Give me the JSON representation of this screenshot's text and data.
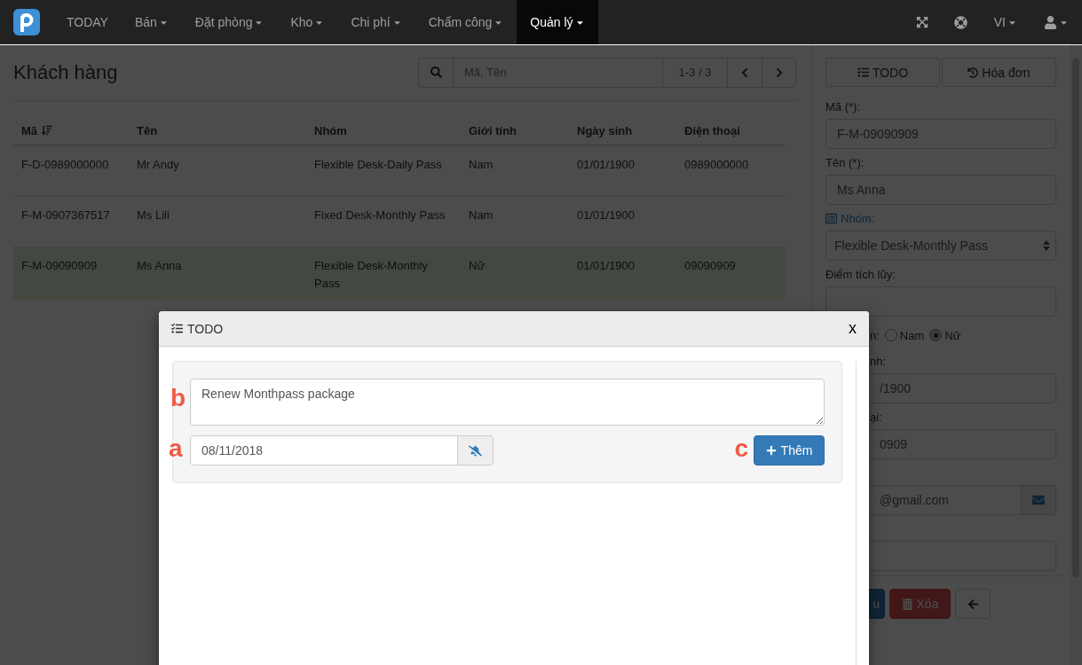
{
  "navbar": {
    "items": [
      {
        "label": "TODAY",
        "dropdown": false,
        "selected": false
      },
      {
        "label": "Bán",
        "dropdown": true,
        "selected": false
      },
      {
        "label": "Đặt phòng",
        "dropdown": true,
        "selected": false
      },
      {
        "label": "Kho",
        "dropdown": true,
        "selected": false
      },
      {
        "label": "Chi phí",
        "dropdown": true,
        "selected": false
      },
      {
        "label": "Chấm công",
        "dropdown": true,
        "selected": false
      },
      {
        "label": "Quản lý",
        "dropdown": true,
        "selected": true
      }
    ],
    "language": "VI"
  },
  "customers": {
    "title": "Khách hàng",
    "search": {
      "placeholder": "Mã, Tên"
    },
    "pager": "1-3 / 3",
    "columns": [
      {
        "label": "Mã",
        "sorted": true
      },
      {
        "label": "Tên",
        "sorted": false
      },
      {
        "label": "Nhóm",
        "sorted": false
      },
      {
        "label": "Giới tính",
        "sorted": false
      },
      {
        "label": "Ngày sinh",
        "sorted": false
      },
      {
        "label": "Điện thoại",
        "sorted": false
      }
    ],
    "rows": [
      {
        "cells": [
          "F-D-0989000000",
          "Mr Andy",
          "Flexible Desk-Daily Pass",
          "Nam",
          "01/01/1900",
          "0989000000"
        ],
        "selected": false
      },
      {
        "cells": [
          "F-M-0907367517",
          "Ms Lili",
          "Fixed Desk-Monthly Pass",
          "Nam",
          "01/01/1900",
          ""
        ],
        "selected": false
      },
      {
        "cells": [
          "F-M-09090909",
          "Ms Anna",
          "Flexible Desk-Monthly Pass",
          "Nữ",
          "01/01/1900",
          "09090909"
        ],
        "selected": true
      }
    ]
  },
  "detail": {
    "tabs": [
      {
        "kind": "todo",
        "label": "TODO"
      },
      {
        "kind": "invoice",
        "label": "Hóa đơn"
      }
    ],
    "fields": [
      {
        "kind": "text",
        "label": "Mã (*):",
        "value": "F-M-09090909"
      },
      {
        "kind": "text",
        "label": "Tên (*):",
        "value": "Ms Anna"
      },
      {
        "kind": "select",
        "label": "Nhóm:",
        "value": "Flexible Desk-Monthly Pass"
      },
      {
        "kind": "text",
        "label": "Điểm tích lũy:"
      }
    ],
    "fields_behind_dialog": [
      {
        "kind": "radio",
        "label": "n:",
        "options": [
          {
            "label": "Nam",
            "selected": false
          },
          {
            "label": "Nữ",
            "selected": true
          }
        ]
      },
      {
        "kind": "text",
        "label": "nh:",
        "value": "/1900"
      },
      {
        "kind": "text",
        "label": "ại:",
        "value": "0909"
      },
      {
        "kind": "email",
        "value": "@gmail.com"
      },
      {
        "kind": "text"
      }
    ],
    "actions": [
      {
        "kind": "save",
        "label": "u"
      },
      {
        "kind": "delete",
        "label": "Xóa"
      },
      {
        "kind": "back"
      }
    ]
  },
  "todo_dialog": {
    "title": "TODO",
    "close": "x",
    "note": {
      "value": "Renew Monthpass package",
      "marker": "b"
    },
    "date": {
      "value": "08/11/2018",
      "marker": "a"
    },
    "add": {
      "label": "Thêm",
      "marker": "c"
    }
  }
}
